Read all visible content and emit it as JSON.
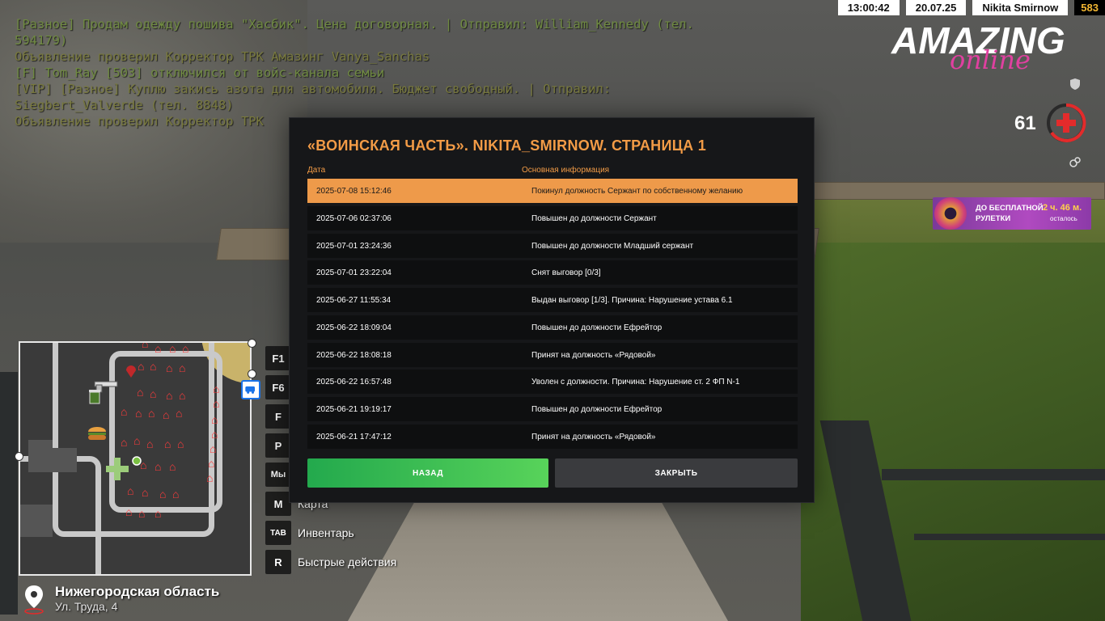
{
  "topbar": {
    "time": "13:00:42",
    "date": "20.07.25",
    "player": "Nikita Smirnow",
    "balance": "583"
  },
  "logo": {
    "main": "AMAZING",
    "sub": "online"
  },
  "hud": {
    "health": "61"
  },
  "roulette": {
    "line1": "ДО БЕСПЛАТНОЙ",
    "line2": "РУЛЕТКИ",
    "time": "2 ч. 46 м.",
    "remaining": "осталось"
  },
  "chat": [
    "[Разное] Продам одежду пошива \"Хасбик\". Цена договорная. | Отправил: William_Kennedy (тел.",
    "594179)",
    "Объявление проверил Корректор ТРК Амазинг Vanya_Sanchas",
    "[F] Tom_Ray [503] отключился от войс-канала семьи",
    "[VIP] [Разное] Куплю закись азота для автомобиля. Бюджет свободный. | Отправил:",
    "Siegbert_Valverde (тел. 8848)",
    "Объявление проверил Корректор ТРК"
  ],
  "hotkeys": [
    {
      "key": "F1",
      "label": ""
    },
    {
      "key": "F6",
      "label": ""
    },
    {
      "key": "F",
      "label": ""
    },
    {
      "key": "P",
      "label": ""
    },
    {
      "key": "Мы",
      "label": ""
    },
    {
      "key": "M",
      "label": "Карта"
    },
    {
      "key": "TAB",
      "label": "Инвентарь"
    },
    {
      "key": "R",
      "label": "Быстрые действия"
    }
  ],
  "location": {
    "region": "Нижегородская область",
    "street": "Ул. Труда, 4"
  },
  "modal": {
    "title": "«ВОИНСКАЯ ЧАСТЬ». NIKITA_SMIRNOW. СТРАНИЦА 1",
    "col_date": "Дата",
    "col_info": "Основная информация",
    "rows": [
      {
        "date": "2025-07-08 15:12:46",
        "info": "Покинул должность Сержант по собственному желанию"
      },
      {
        "date": "2025-07-06 02:37:06",
        "info": "Повышен до должности Сержант"
      },
      {
        "date": "2025-07-01 23:24:36",
        "info": "Повышен до должности Младший сержант"
      },
      {
        "date": "2025-07-01 23:22:04",
        "info": "Снят выговор [0/3]"
      },
      {
        "date": "2025-06-27 11:55:34",
        "info": "Выдан выговор [1/3]. Причина: Нарушение устава 6.1"
      },
      {
        "date": "2025-06-22 18:09:04",
        "info": "Повышен до должности Ефрейтор"
      },
      {
        "date": "2025-06-22 18:08:18",
        "info": "Принят на должность «Рядовой»"
      },
      {
        "date": "2025-06-22 16:57:48",
        "info": "Уволен с должности. Причина: Нарушение ст. 2 ФП N-1"
      },
      {
        "date": "2025-06-21 19:19:17",
        "info": "Повышен до должности Ефрейтор"
      },
      {
        "date": "2025-06-21 17:47:12",
        "info": "Принят на должность «Рядовой»"
      }
    ],
    "btn_back": "НАЗАД",
    "btn_close": "ЗАКРЫТЬ"
  },
  "colors": {
    "accent": "#f29b46",
    "health": "#e32b2b",
    "back_button": "#3bc453",
    "chat": "#6f8a41"
  }
}
